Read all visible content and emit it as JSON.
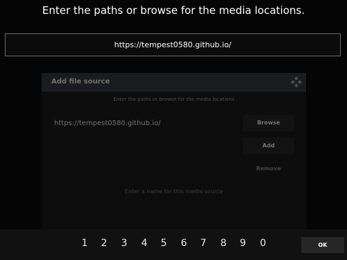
{
  "prompt": "Enter the paths or browse for the media locations.",
  "url_field": {
    "value": "https://tempest0580.github.io/"
  },
  "background_dialog": {
    "title": "Add file source",
    "prompt": "Enter the paths or browse for the media locations",
    "path": "https://tempest0580.github.io/",
    "browse_label": "Browse",
    "add_label": "Add",
    "remove_label": "Remove",
    "hint": "Enter a name for this media source"
  },
  "numpad": [
    "1",
    "2",
    "3",
    "4",
    "5",
    "6",
    "7",
    "8",
    "9",
    "0"
  ],
  "ok_label": "OK"
}
